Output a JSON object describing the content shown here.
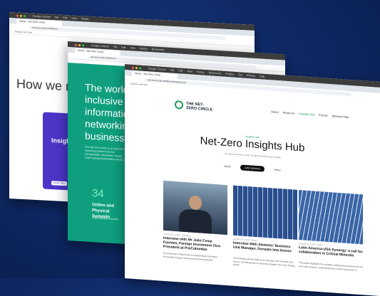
{
  "browser": {
    "app": "Google Chrome",
    "menu": [
      "File",
      "Edit",
      "View",
      "History",
      "Bookmarks",
      "Profiles",
      "Tab",
      "Window",
      "Help"
    ]
  },
  "window1": {
    "tab": "Home - Net-Zero Circle",
    "url": "net-zero-circle.webflow.io",
    "bookmark": "Resume and Start...",
    "hero": "How we n",
    "card_title": "Insights",
    "card_button": "VISIT INSI"
  },
  "window2": {
    "tab": "Home - Net-Zero Circle",
    "url": "net-zero-circle.webflow.io",
    "hero": "The world's inclusive N information networking business p",
    "body": "The Net-Zero Circle is an exclusive networking platform for the transportation, distribution, supply chain leading sustainability experts...",
    "stat": "34",
    "stat_label": "Online and Physical Summits",
    "stat_sub": "in ten different countries"
  },
  "window3": {
    "tab": "Home - Net-Zero Circle",
    "url": "net-zero-circle.webflow.io/insights-hub",
    "bookmark": "Resume and Start...",
    "logo": "THE NET-ZERO CIRCLE",
    "nav": [
      "Home",
      "About Us",
      "Insights Hub",
      "Events",
      "Member Map"
    ],
    "eyebrow": "Insights Hub",
    "title": "Net-Zero Insights Hub",
    "subtitle": "The latest interviews, news, thought leadership and analysis",
    "filters": [
      "World",
      "Latin America",
      "Africa"
    ],
    "articles": [
      {
        "meta": "January 01, 2024 · Colombia",
        "title": "Interview with Mr Julio Cesar Fuentes, Foreign Investment Vice-President at ProColombia",
        "excerpt": "ProColombia's Partial Role in Accelerating Colombia's Renewable Energy Investment and Development"
      },
      {
        "meta": "January 01, 2024 · Brazil",
        "title": "Interview With Siemens' Business Unit Manager, Genzato Ima Scoroz",
        "excerpt": "The following article features an interview with Genzato Ima Scoroz, shedding light on Siemens' integral role in the Energy sector..."
      },
      {
        "meta": "January 01, 2024 · Chile",
        "title": "Latin America-USA Synergy: a call for collaboration in Critical Minerals",
        "excerpt": "The article highlights the strategic collaboration between the US and Latin America, emphasizing the crucial importance of..."
      }
    ]
  }
}
